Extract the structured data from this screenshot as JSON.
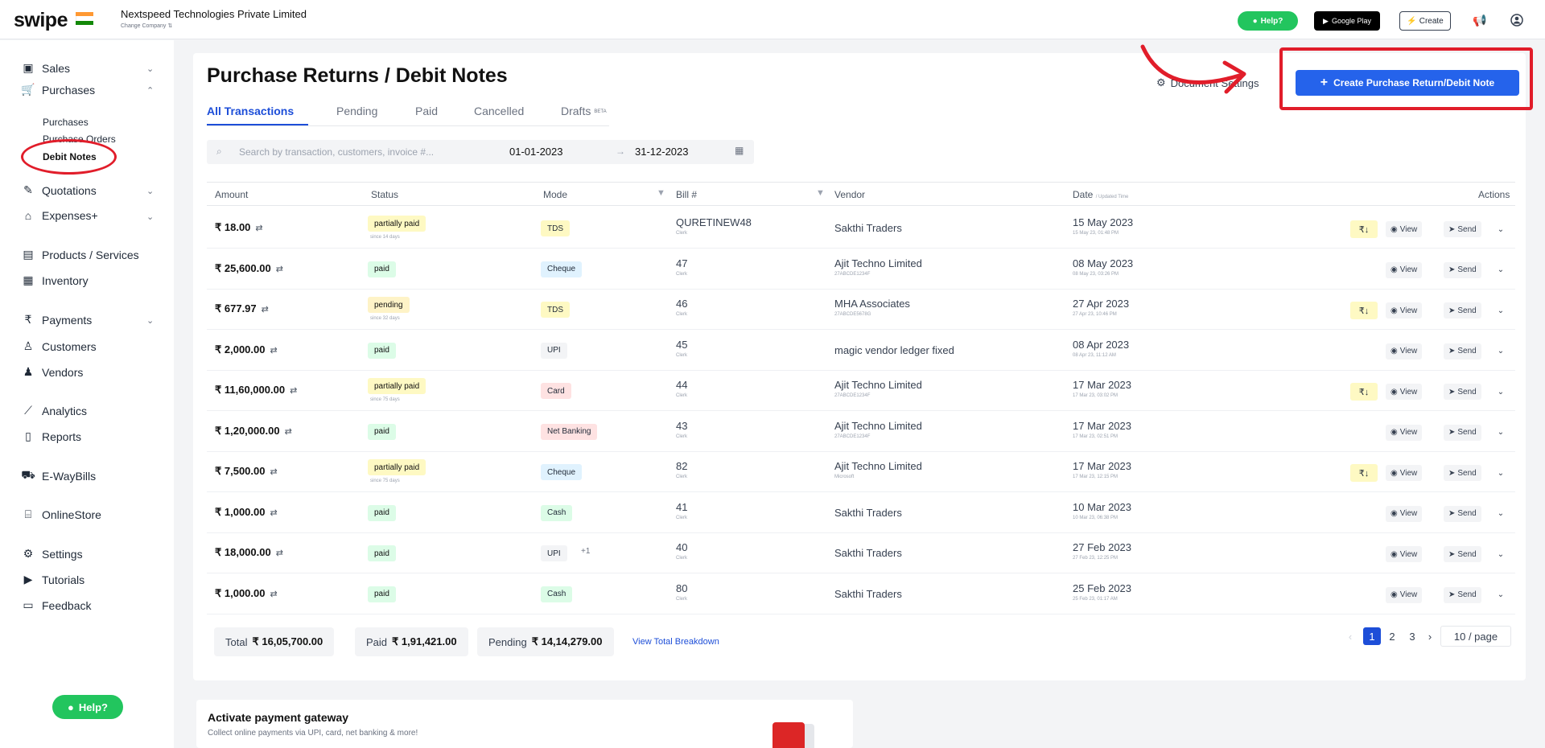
{
  "topbar": {
    "logo": "swipe",
    "company_name": "Nextspeed Technologies Private Limited",
    "company_sub": "Change Company ⇅",
    "help_label": "Help?",
    "play_label": "Google Play",
    "create_label": "Create"
  },
  "sidebar": {
    "items": [
      {
        "label": "Sales"
      },
      {
        "label": "Purchases"
      },
      {
        "label": "Quotations"
      },
      {
        "label": "Expenses+"
      },
      {
        "label": "Products / Services"
      },
      {
        "label": "Inventory"
      },
      {
        "label": "Payments"
      },
      {
        "label": "Customers"
      },
      {
        "label": "Vendors"
      },
      {
        "label": "Analytics"
      },
      {
        "label": "Reports"
      },
      {
        "label": "E-WayBills"
      },
      {
        "label": "OnlineStore"
      },
      {
        "label": "Settings"
      },
      {
        "label": "Tutorials"
      },
      {
        "label": "Feedback"
      }
    ],
    "sub_items": [
      {
        "label": "Purchases"
      },
      {
        "label": "Purchase Orders"
      },
      {
        "label": "Debit Notes"
      }
    ],
    "help_label": "Help?"
  },
  "page": {
    "title": "Purchase Returns / Debit Notes",
    "tabs": [
      {
        "label": "All Transactions"
      },
      {
        "label": "Pending"
      },
      {
        "label": "Paid"
      },
      {
        "label": "Cancelled"
      },
      {
        "label": "Drafts"
      }
    ],
    "beta_label": "BETA",
    "document_settings": "Document Settings",
    "create_button": "Create Purchase Return/Debit Note",
    "search_placeholder": "Search by transaction, customers, invoice #...",
    "date_from": "01-01-2023",
    "date_to": "31-12-2023"
  },
  "table": {
    "headers": {
      "amount": "Amount",
      "status": "Status",
      "mode": "Mode",
      "bill": "Bill #",
      "vendor": "Vendor",
      "date": "Date",
      "date_sub": "/ Updated Time",
      "actions": "Actions"
    },
    "view_label": "View",
    "send_label": "Send",
    "rows": [
      {
        "amount": "₹ 18.00",
        "status": "partially paid",
        "status_note": "since 14 days",
        "mode": "TDS",
        "mode_extra": "",
        "bill": "QURETINEW48",
        "bill_sub": "Clerk",
        "vendor": "Sakthi Traders",
        "vendor_sub": "",
        "date": "15 May 2023",
        "date_sub": "15 May 23, 01:48 PM",
        "has_rupee": true
      },
      {
        "amount": "₹ 25,600.00",
        "status": "paid",
        "status_note": "",
        "mode": "Cheque",
        "mode_extra": "",
        "bill": "47",
        "bill_sub": "Clerk",
        "vendor": "Ajit Techno Limited",
        "vendor_sub": "27ABCDE1234F",
        "date": "08 May 2023",
        "date_sub": "08 May 23, 03:26 PM",
        "has_rupee": false
      },
      {
        "amount": "₹ 677.97",
        "status": "pending",
        "status_note": "since 32 days",
        "mode": "TDS",
        "mode_extra": "",
        "bill": "46",
        "bill_sub": "Clerk",
        "vendor": "MHA Associates",
        "vendor_sub": "27ABCDE5678G",
        "date": "27 Apr 2023",
        "date_sub": "27 Apr 23, 10:46 PM",
        "has_rupee": true
      },
      {
        "amount": "₹ 2,000.00",
        "status": "paid",
        "status_note": "",
        "mode": "UPI",
        "mode_extra": "",
        "bill": "45",
        "bill_sub": "Clerk",
        "vendor": "magic vendor ledger fixed",
        "vendor_sub": "",
        "date": "08 Apr 2023",
        "date_sub": "08 Apr 23, 11:12 AM",
        "has_rupee": false
      },
      {
        "amount": "₹ 11,60,000.00",
        "status": "partially paid",
        "status_note": "since 75 days",
        "mode": "Card",
        "mode_extra": "",
        "bill": "44",
        "bill_sub": "Clerk",
        "vendor": "Ajit Techno Limited",
        "vendor_sub": "27ABCDE1234F",
        "date": "17 Mar 2023",
        "date_sub": "17 Mar 23, 03:02 PM",
        "has_rupee": true
      },
      {
        "amount": "₹ 1,20,000.00",
        "status": "paid",
        "status_note": "",
        "mode": "Net Banking",
        "mode_extra": "",
        "bill": "43",
        "bill_sub": "Clerk",
        "vendor": "Ajit Techno Limited",
        "vendor_sub": "27ABCDE1234F",
        "date": "17 Mar 2023",
        "date_sub": "17 Mar 23, 02:51 PM",
        "has_rupee": false
      },
      {
        "amount": "₹ 7,500.00",
        "status": "partially paid",
        "status_note": "since 75 days",
        "mode": "Cheque",
        "mode_extra": "",
        "bill": "82",
        "bill_sub": "Clerk",
        "vendor": "Ajit Techno Limited",
        "vendor_sub": "Microsoft",
        "date": "17 Mar 2023",
        "date_sub": "17 Mar 23, 12:15 PM",
        "has_rupee": true
      },
      {
        "amount": "₹ 1,000.00",
        "status": "paid",
        "status_note": "",
        "mode": "Cash",
        "mode_extra": "",
        "bill": "41",
        "bill_sub": "Clerk",
        "vendor": "Sakthi Traders",
        "vendor_sub": "",
        "date": "10 Mar 2023",
        "date_sub": "10 Mar 23, 06:38 PM",
        "has_rupee": false
      },
      {
        "amount": "₹ 18,000.00",
        "status": "paid",
        "status_note": "",
        "mode": "UPI",
        "mode_extra": "+1",
        "bill": "40",
        "bill_sub": "Clerk",
        "vendor": "Sakthi Traders",
        "vendor_sub": "",
        "date": "27 Feb 2023",
        "date_sub": "27 Feb 23, 12:25 PM",
        "has_rupee": false
      },
      {
        "amount": "₹ 1,000.00",
        "status": "paid",
        "status_note": "",
        "mode": "Cash",
        "mode_extra": "",
        "bill": "80",
        "bill_sub": "Clerk",
        "vendor": "Sakthi Traders",
        "vendor_sub": "",
        "date": "25 Feb 2023",
        "date_sub": "25 Feb 23, 01:17 AM",
        "has_rupee": false
      }
    ]
  },
  "totals": {
    "total_label": "Total",
    "total_value": "₹ 16,05,700.00",
    "paid_label": "Paid",
    "paid_value": "₹ 1,91,421.00",
    "pending_label": "Pending",
    "pending_value": "₹ 14,14,279.00",
    "breakdown_link": "View Total Breakdown"
  },
  "pagination": {
    "pages": [
      "1",
      "2",
      "3"
    ],
    "current": "1",
    "page_size": "10 / page"
  },
  "gateway": {
    "title": "Activate payment gateway",
    "subtitle": "Collect online payments via UPI, card, net banking & more!"
  }
}
